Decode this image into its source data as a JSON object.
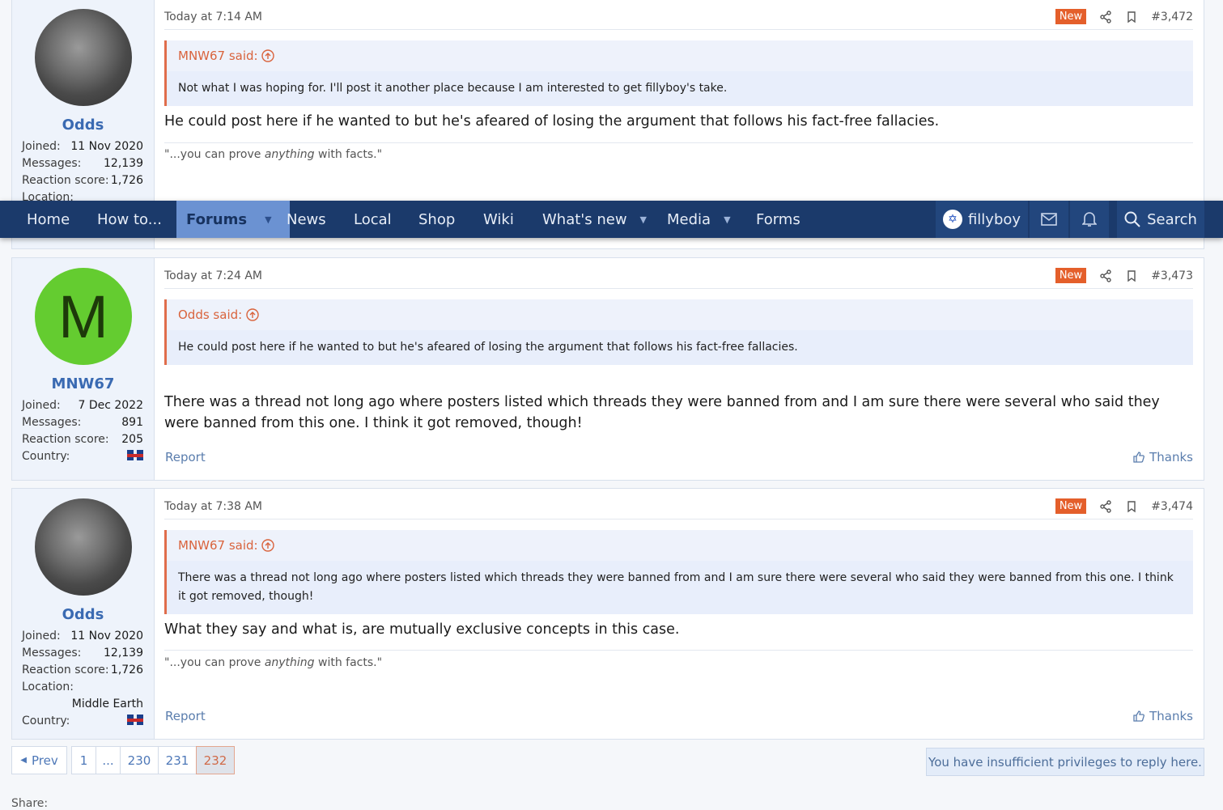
{
  "nav": {
    "items": [
      "Home",
      "How to...",
      "Forums",
      "News",
      "Local",
      "Shop",
      "Wiki",
      "What's new",
      "Media",
      "Forms"
    ],
    "user": "fillyboy",
    "search": "Search"
  },
  "posts": [
    {
      "date": "Today at 7:14 AM",
      "badge": "New",
      "number": "#3,472",
      "author": "Odds",
      "stats": [
        {
          "k": "Joined:",
          "v": "11 Nov 2020"
        },
        {
          "k": "Messages:",
          "v": "12,139"
        },
        {
          "k": "Reaction score:",
          "v": "1,726"
        },
        {
          "k": "Location:",
          "v": ""
        }
      ],
      "quote_author": "MNW67 said:",
      "quote_text": "Not what I was hoping for. I'll post it another place because I am interested to get fillyboy's take.",
      "message": "He could post here if he wanted to but he's afeared of losing the argument that follows his fact-free fallacies.",
      "sig_pre": "\"...you can prove ",
      "sig_em": "anything",
      "sig_post": " with facts.\""
    },
    {
      "date": "Today at 7:24 AM",
      "badge": "New",
      "number": "#3,473",
      "author": "MNW67",
      "avatar_letter": "M",
      "stats": [
        {
          "k": "Joined:",
          "v": "7 Dec 2022"
        },
        {
          "k": "Messages:",
          "v": "891"
        },
        {
          "k": "Reaction score:",
          "v": "205"
        },
        {
          "k": "Country:",
          "v": ""
        }
      ],
      "quote_author": "Odds said:",
      "quote_text": "He could post here if he wanted to but he's afeared of losing the argument that follows his fact-free fallacies.",
      "message": "There was a thread not long ago where posters listed which threads they were banned from and I am sure there were several who said they were banned from this one. I think it got removed, though!",
      "report": "Report",
      "thanks": "Thanks"
    },
    {
      "date": "Today at 7:38 AM",
      "badge": "New",
      "number": "#3,474",
      "author": "Odds",
      "stats": [
        {
          "k": "Joined:",
          "v": "11 Nov 2020"
        },
        {
          "k": "Messages:",
          "v": "12,139"
        },
        {
          "k": "Reaction score:",
          "v": "1,726"
        },
        {
          "k": "Location:",
          "v": ""
        },
        {
          "k": "",
          "v": "Middle Earth"
        },
        {
          "k": "Country:",
          "v": ""
        }
      ],
      "quote_author": "MNW67 said:",
      "quote_text": "There was a thread not long ago where posters listed which threads they were banned from and I am sure there were several who said they were banned from this one. I think it got removed, though!",
      "message": "What they say and what is, are mutually exclusive concepts in this case.",
      "sig_pre": "\"...you can prove ",
      "sig_em": "anything",
      "sig_post": " with facts.\"",
      "report": "Report",
      "thanks": "Thanks"
    }
  ],
  "pagination": {
    "prev": "Prev",
    "pages": [
      "1",
      "...",
      "230",
      "231",
      "232"
    ],
    "current": "232"
  },
  "notice": "You have insufficient privileges to reply here.",
  "share_label": "Share:"
}
